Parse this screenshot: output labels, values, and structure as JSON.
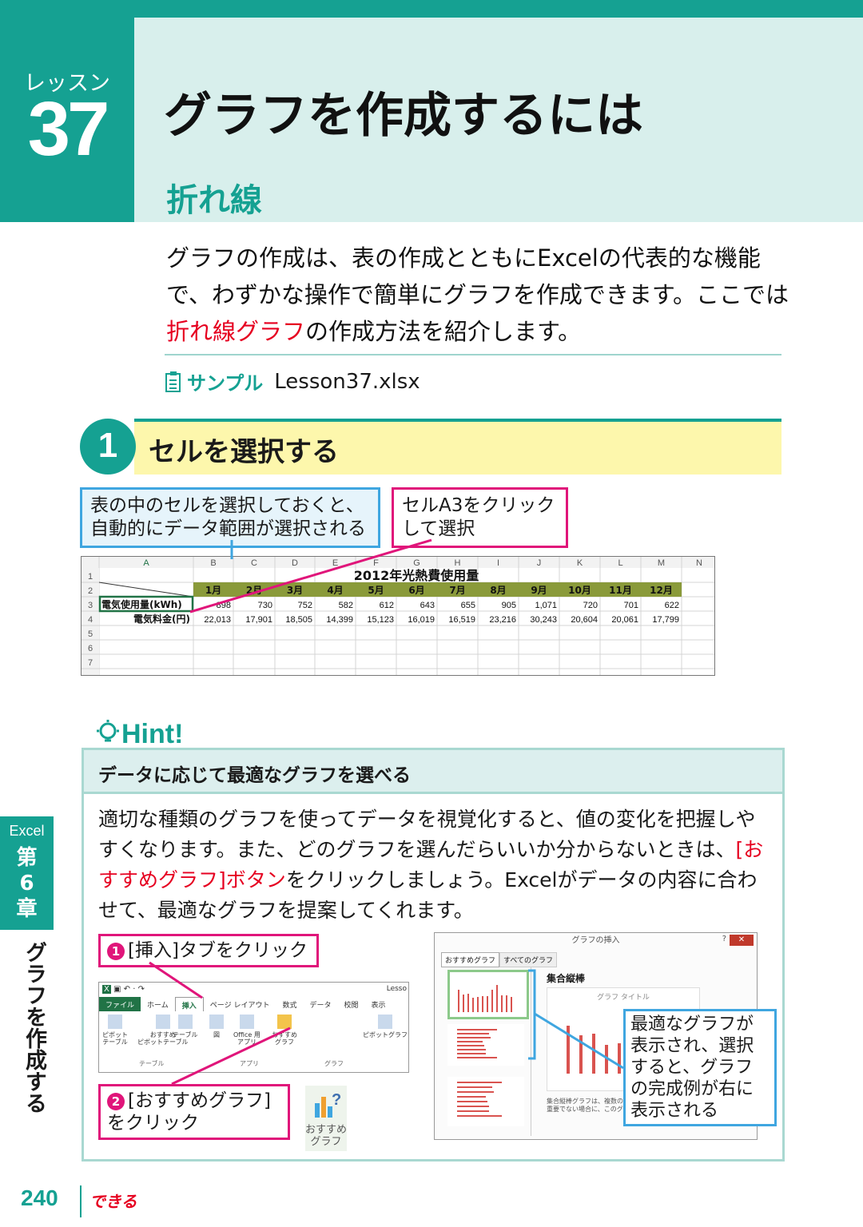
{
  "lesson": {
    "label": "レッスン",
    "number": "37"
  },
  "title": "グラフを作成するには",
  "subtitle": "折れ線",
  "intro": {
    "part1": "グラフの作成は、表の作成とともにExcelの代表的な機能で、わずかな操作で簡単にグラフを作成できます。ここでは",
    "highlight": "折れ線グラフ",
    "part2": "の作成方法を紹介します。"
  },
  "sample": {
    "label": "サンプル",
    "file": "Lesson37.xlsx"
  },
  "step": {
    "number": "1",
    "title": "セルを選択する"
  },
  "callouts": {
    "blue": "表の中のセルを選択しておくと、\n自動的にデータ範囲が選択される",
    "pink": "セルA3をクリック\nして選択"
  },
  "sheet": {
    "col_headers": [
      "A",
      "B",
      "C",
      "D",
      "E",
      "F",
      "G",
      "H",
      "I",
      "J",
      "K",
      "L",
      "M",
      "N"
    ],
    "row_numbers": [
      "1",
      "2",
      "3",
      "4",
      "5",
      "6",
      "7"
    ],
    "title": "2012年光熱費使用量",
    "months": [
      "1月",
      "2月",
      "3月",
      "4月",
      "5月",
      "6月",
      "7月",
      "8月",
      "9月",
      "10月",
      "11月",
      "12月"
    ],
    "rows": [
      {
        "label": "電気使用量(kWh)",
        "values": [
          "898",
          "730",
          "752",
          "582",
          "612",
          "643",
          "655",
          "905",
          "1,071",
          "720",
          "701",
          "622"
        ]
      },
      {
        "label": "電気料金(円)",
        "values": [
          "22,013",
          "17,901",
          "18,505",
          "14,399",
          "15,123",
          "16,019",
          "16,519",
          "23,216",
          "30,243",
          "20,604",
          "20,061",
          "17,799"
        ]
      }
    ]
  },
  "hint": {
    "logo": "Hint!",
    "title": "データに応じて最適なグラフを選べる",
    "body1": "適切な種類のグラフを使ってデータを視覚化すると、値の変化を把握しやすくなります。また、どのグラフを選んだらいいか分からないときは、",
    "highlight": "[おすすめグラフ]ボタン",
    "body2": "をクリックしましょう。Excelがデータの内容に合わせて、最適なグラフを提案してくれます。",
    "step1_num": "1",
    "step1": "[挿入]タブをクリック",
    "step2_num": "2",
    "step2": "[おすすめグラフ]\nをクリック",
    "ribbon": {
      "filename": "Lesso",
      "tabs": [
        "ファイル",
        "ホーム",
        "挿入",
        "ページ レイアウト",
        "数式",
        "データ",
        "校閲",
        "表示"
      ],
      "groups": [
        "テーブル",
        "アプリ",
        "グラフ"
      ],
      "buttons": [
        "ピボット\nテーブル",
        "おすすめ\nピボットテーブル",
        "テーブル",
        "図",
        "Office 用\nアプリ",
        "おすすめ\nグラフ",
        "ピボットグラフ"
      ]
    },
    "dialog": {
      "title": "グラフの挿入",
      "tabs": [
        "おすすめグラフ",
        "すべてのグラフ"
      ],
      "chart_name": "集合縦棒",
      "chart_title": "グラフ タイトル",
      "desc": "集合縦棒グラフは、複数の項目を\n重要でない場合に、このグラフを使"
    },
    "dialog_callout": "最適なグラフが\n表示され、選択\nすると、グラフ\nの完成例が右に\n表示される",
    "rec_icon_label": "おすすめ\nグラフ"
  },
  "side": {
    "app": "Excel",
    "chapter": "第\n6\n章",
    "vertical": "グラフを作成する"
  },
  "footer": {
    "page": "240",
    "brand": "できる"
  },
  "colors": {
    "teal": "#15a192",
    "red": "#e60020",
    "pink": "#e0157a",
    "blue": "#3fa6e0",
    "yellow": "#fdf7ac"
  }
}
